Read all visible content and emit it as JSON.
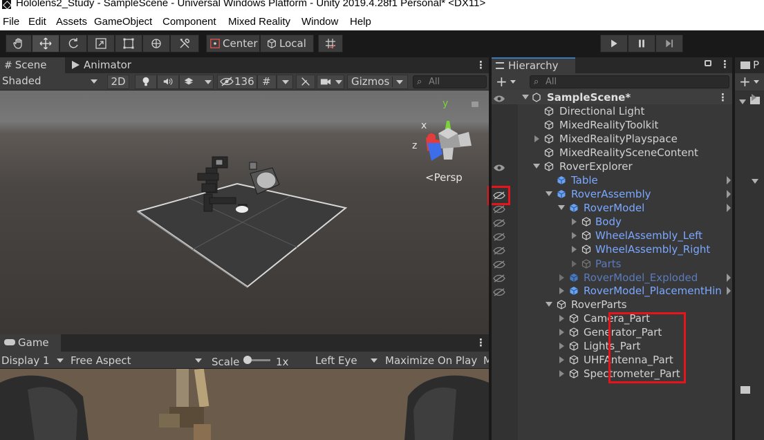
{
  "window": {
    "title": "Hololens2_Study - SampleScene - Universal Windows Platform - Unity 2019.4.28f1 Personal* <DX11>"
  },
  "menu": [
    "File",
    "Edit",
    "Assets",
    "GameObject",
    "Component",
    "Mixed Reality",
    "Window",
    "Help"
  ],
  "toolbar": {
    "pivot_mode": "Center",
    "pivot_rotation": "Local"
  },
  "scene_panel": {
    "tabs": [
      "Scene",
      "Animator"
    ],
    "shading_mode": "Shaded",
    "mode_2d": "2D",
    "hidden_count": "136",
    "gizmos_label": "Gizmos",
    "search_placeholder": "All",
    "persp_label": "Persp",
    "axis_y": "y",
    "axis_x": "x",
    "axis_z": "z"
  },
  "game_panel": {
    "tab": "Game",
    "display": "Display 1",
    "aspect": "Free Aspect",
    "scale_label": "Scale",
    "scale_value": "1x",
    "eye": "Left Eye",
    "maximize": "Maximize On Play",
    "truncated": "M"
  },
  "hierarchy": {
    "tab": "Hierarchy",
    "search_placeholder": "All",
    "scene_name": "SampleScene*",
    "items": [
      {
        "label": "Directional Light"
      },
      {
        "label": "MixedRealityToolkit"
      },
      {
        "label": "MixedRealityPlayspace"
      },
      {
        "label": "MixedRealitySceneContent"
      },
      {
        "label": "RoverExplorer"
      },
      {
        "label": "Table"
      },
      {
        "label": "RoverAssembly"
      },
      {
        "label": "RoverModel"
      },
      {
        "label": "Body"
      },
      {
        "label": "WheelAssembly_Left"
      },
      {
        "label": "WheelAssembly_Right"
      },
      {
        "label": "Parts"
      },
      {
        "label": "RoverModel_Exploded"
      },
      {
        "label": "RoverModel_PlacementHin"
      },
      {
        "label": "RoverParts"
      },
      {
        "label": "Camera_Part"
      },
      {
        "label": "Generator_Part"
      },
      {
        "label": "Lights_Part"
      },
      {
        "label": "UHFAntenna_Part"
      },
      {
        "label": "Spectrometer_Part"
      }
    ]
  },
  "project_panel": {
    "tab_initial": "P"
  },
  "colors": {
    "prefab_text": "#7ba8ff",
    "highlight_box": "#e8141c",
    "panel_bg": "#383838"
  }
}
